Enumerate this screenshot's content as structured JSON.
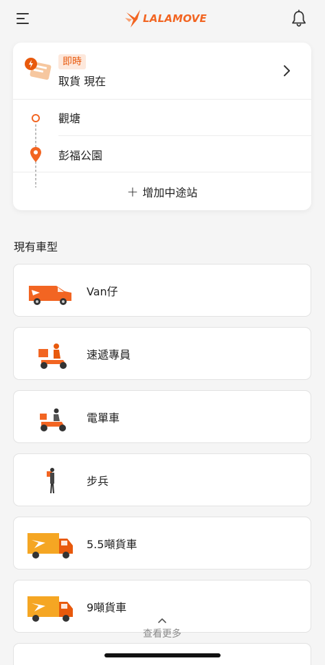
{
  "app": {
    "logo_text": "LALAMOVE",
    "brand_color": "#f26522"
  },
  "route": {
    "badge": "即時",
    "pickup_time": "取貨 現在",
    "stops": [
      {
        "label": "觀塘",
        "type": "pickup"
      },
      {
        "label": "彭福公園",
        "type": "dropoff"
      }
    ],
    "add_stop_label": "增加中途站",
    "add_stop_icon": "+"
  },
  "section_title": "現有車型",
  "vehicles": [
    {
      "name": "Van仔",
      "icon": "van-icon"
    },
    {
      "name": "速遞專員",
      "icon": "courier-icon"
    },
    {
      "name": "電單車",
      "icon": "motorcycle-icon"
    },
    {
      "name": "步兵",
      "icon": "walker-icon"
    },
    {
      "name": "5.5噸貨車",
      "icon": "truck-icon"
    },
    {
      "name": "9噸貨車",
      "icon": "truck-icon"
    }
  ],
  "more_label": "查看更多"
}
